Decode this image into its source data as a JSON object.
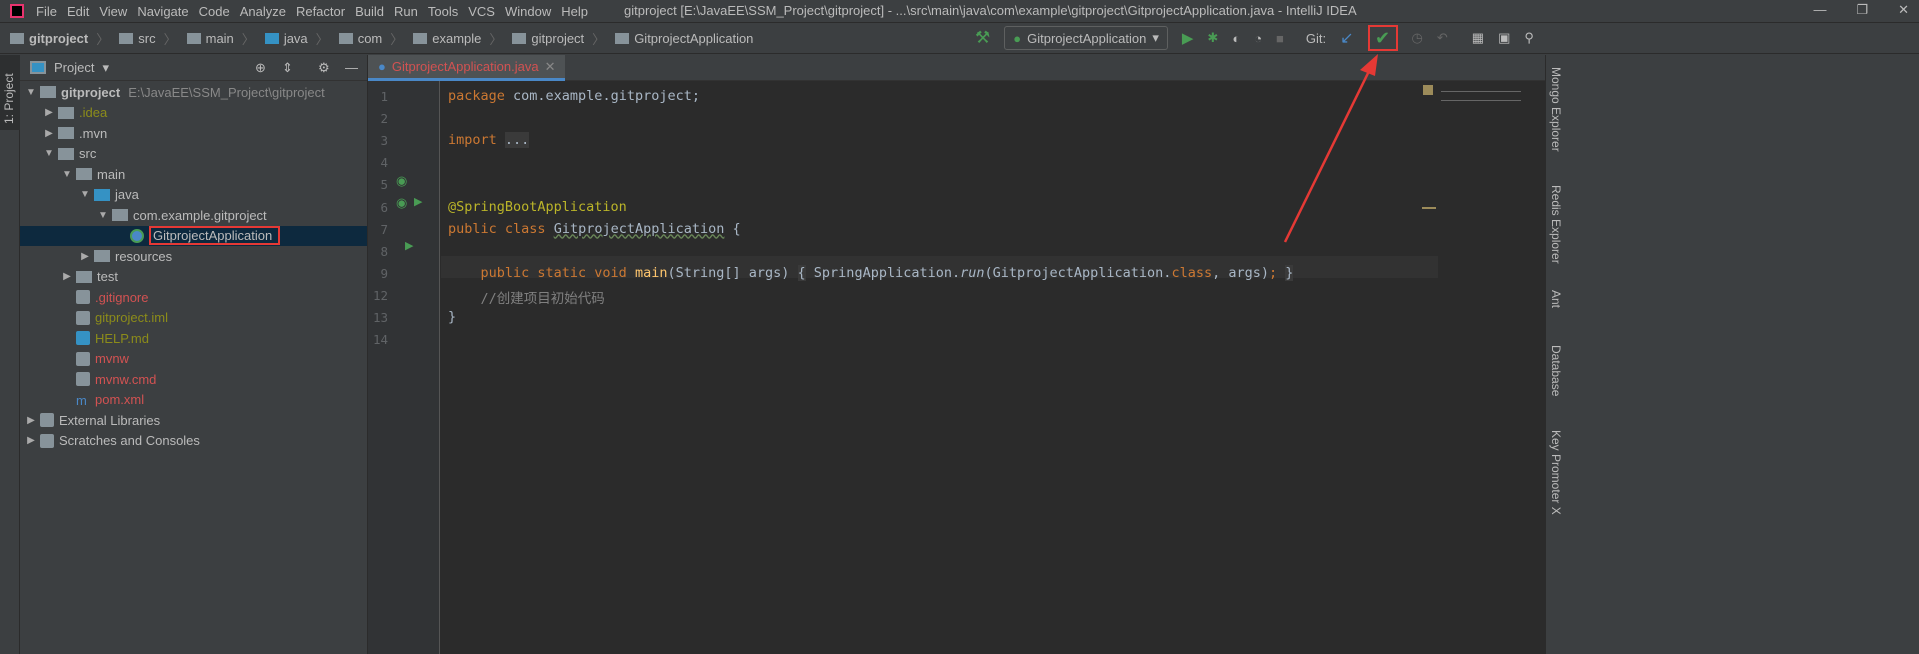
{
  "menu": [
    "File",
    "Edit",
    "View",
    "Navigate",
    "Code",
    "Analyze",
    "Refactor",
    "Build",
    "Run",
    "Tools",
    "VCS",
    "Window",
    "Help"
  ],
  "window_title": "gitproject [E:\\JavaEE\\SSM_Project\\gitproject] - ...\\src\\main\\java\\com\\example\\gitproject\\GitprojectApplication.java - IntelliJ IDEA",
  "breadcrumbs": [
    "gitproject",
    "src",
    "main",
    "java",
    "com",
    "example",
    "gitproject",
    "GitprojectApplication"
  ],
  "run_config": "GitprojectApplication",
  "git_label": "Git:",
  "left_tab": "1: Project",
  "project_panel": {
    "title": "Project",
    "tree": [
      {
        "label": "gitproject",
        "extra": "E:\\JavaEE\\SSM_Project\\gitproject",
        "depth": 0,
        "arrow": "down",
        "color": "#bbbbbb",
        "icon": "module-folder"
      },
      {
        "label": ".idea",
        "depth": 1,
        "arrow": "right",
        "color": "#8c8c1a",
        "icon": "folder"
      },
      {
        "label": ".mvn",
        "depth": 1,
        "arrow": "right",
        "color": "#bbbbbb",
        "icon": "folder"
      },
      {
        "label": "src",
        "depth": 1,
        "arrow": "down",
        "color": "#bbbbbb",
        "icon": "folder"
      },
      {
        "label": "main",
        "depth": 2,
        "arrow": "down",
        "color": "#bbbbbb",
        "icon": "folder"
      },
      {
        "label": "java",
        "depth": 3,
        "arrow": "down",
        "color": "#bbbbbb",
        "icon": "source-folder"
      },
      {
        "label": "com.example.gitproject",
        "depth": 4,
        "arrow": "down",
        "color": "#bbbbbb",
        "icon": "package"
      },
      {
        "label": "GitprojectApplication",
        "depth": 5,
        "arrow": "",
        "color": "#bbbbbb",
        "icon": "spring-class",
        "selected": true
      },
      {
        "label": "resources",
        "depth": 3,
        "arrow": "right",
        "color": "#bbbbbb",
        "icon": "folder"
      },
      {
        "label": "test",
        "depth": 2,
        "arrow": "right",
        "color": "#bbbbbb",
        "icon": "folder"
      },
      {
        "label": ".gitignore",
        "depth": 2,
        "arrow": "",
        "color": "#d25252",
        "icon": "file"
      },
      {
        "label": "gitproject.iml",
        "depth": 2,
        "arrow": "",
        "color": "#8c8c1a",
        "icon": "file"
      },
      {
        "label": "HELP.md",
        "depth": 2,
        "arrow": "",
        "color": "#8c8c1a",
        "icon": "markdown"
      },
      {
        "label": "mvnw",
        "depth": 2,
        "arrow": "",
        "color": "#d25252",
        "icon": "terminal"
      },
      {
        "label": "mvnw.cmd",
        "depth": 2,
        "arrow": "",
        "color": "#d25252",
        "icon": "file"
      },
      {
        "label": "pom.xml",
        "depth": 2,
        "arrow": "",
        "color": "#d25252",
        "icon": "maven"
      },
      {
        "label": "External Libraries",
        "depth": 0,
        "arrow": "right",
        "color": "#bbbbbb",
        "icon": "libraries"
      },
      {
        "label": "Scratches and Consoles",
        "depth": 0,
        "arrow": "right",
        "color": "#bbbbbb",
        "icon": "scratches"
      }
    ]
  },
  "editor": {
    "tab": "GitprojectApplication.java",
    "lines": [
      {
        "n": "1",
        "html": "<span class='kw'>package</span> com.example.gitproject;"
      },
      {
        "n": "2",
        "html": ""
      },
      {
        "n": "3",
        "html": "<span class='kw'>import</span> <span style='background:#3a3a3a'>...</span>"
      },
      {
        "n": "4",
        "html": ""
      },
      {
        "n": "5",
        "html": ""
      },
      {
        "n": "6",
        "html": "<span class='ann'>@SpringBootApplication</span>"
      },
      {
        "n": "7",
        "html": "<span class='kw'>public class</span> <span style='text-decoration:underline wavy #6a8759'>GitprojectApplication</span> {"
      },
      {
        "n": "8",
        "html": ""
      },
      {
        "n": "9",
        "html": "    <span class='kw'>public static void</span> <span class='fn'>main</span>(String[] args) <span style='background:#3a3a3a'>{</span> SpringApplication.<span class='it'>run</span>(GitprojectApplication.<span class='kw'>class</span>, args)<span class='kw'>;</span> <span style='background:#3a3a3a'>}</span>"
      },
      {
        "n": "12",
        "html": "    <span class='cm'>//创建项目初始代码</span>"
      },
      {
        "n": "13",
        "html": "}"
      },
      {
        "n": "14",
        "html": ""
      }
    ]
  },
  "right_tools": [
    "Mongo Explorer",
    "Redis Explorer",
    "Ant",
    "Database",
    "Key Promoter X"
  ],
  "colors": {
    "highlight": "#e53935",
    "accent": "#4a88c7",
    "green": "#499c54"
  }
}
